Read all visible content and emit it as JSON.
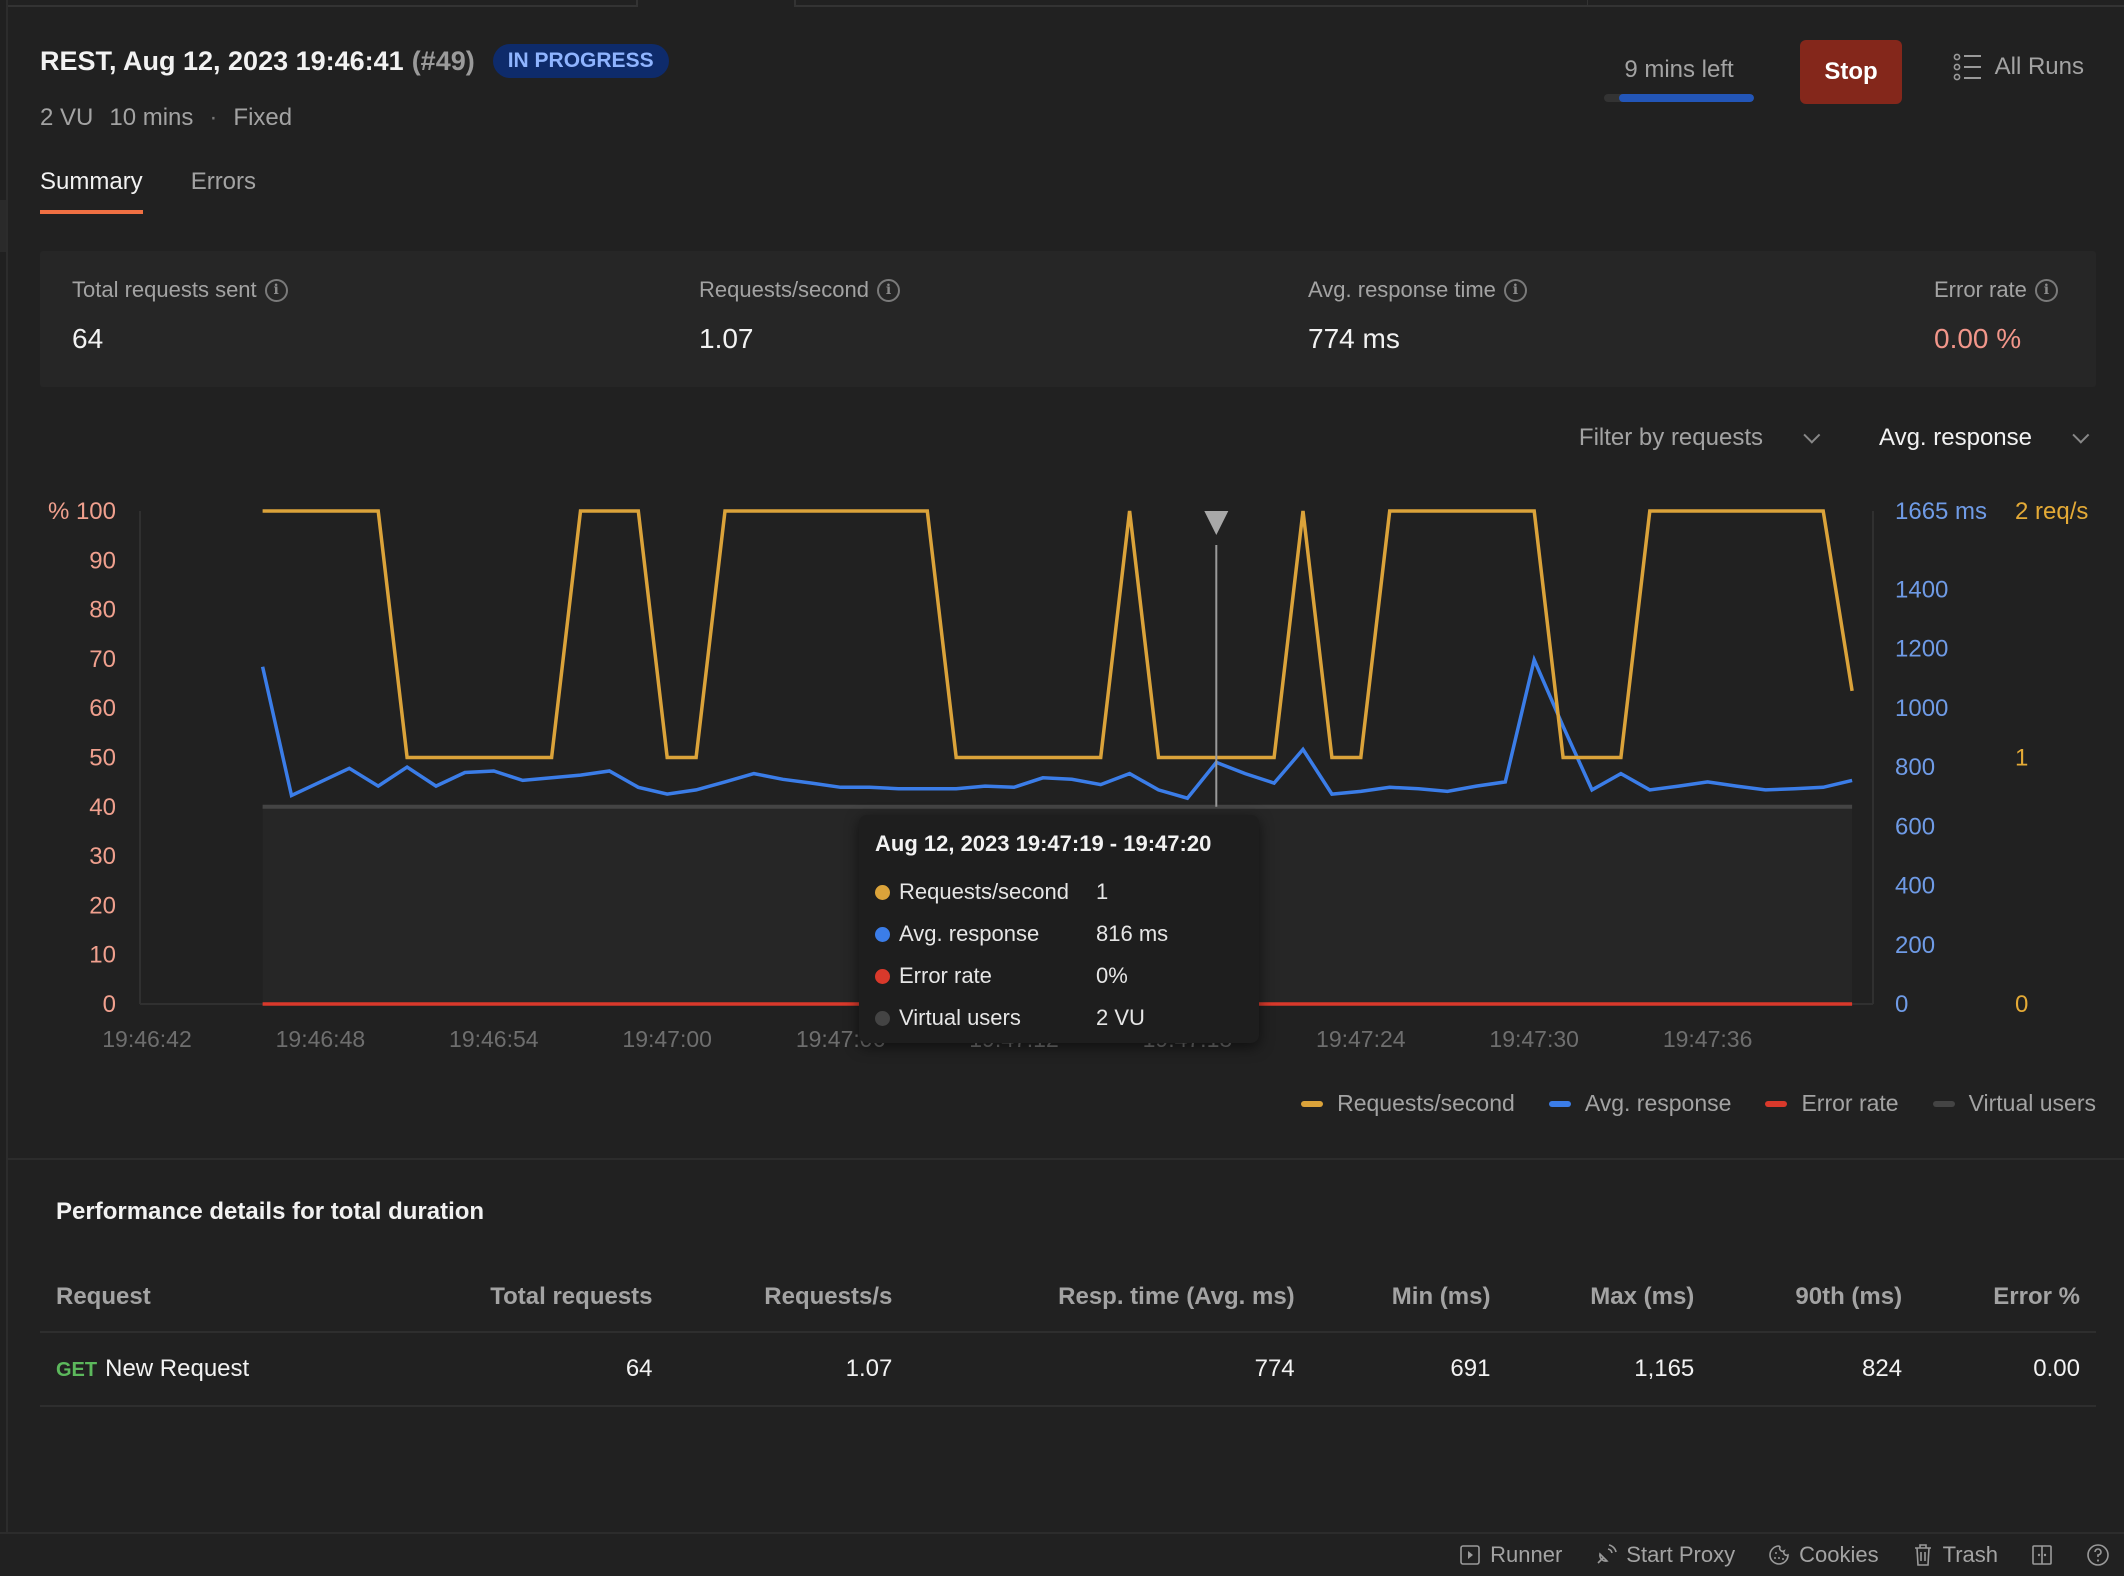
{
  "header": {
    "run_title": "REST, Aug 12, 2023 19:46:41",
    "run_number": "(#49)",
    "status": "IN PROGRESS",
    "meta": {
      "vus": "2 VU",
      "duration": "10 mins",
      "separator": "·",
      "profile": "Fixed"
    },
    "time_left": "9 mins left",
    "elapsed_fraction": 0.1,
    "stop_label": "Stop",
    "all_runs_label": "All Runs"
  },
  "tabs": [
    {
      "label": "Summary",
      "active": true
    },
    {
      "label": "Errors",
      "active": false
    }
  ],
  "stats": [
    {
      "label": "Total requests sent",
      "value": "64"
    },
    {
      "label": "Requests/second",
      "value": "1.07"
    },
    {
      "label": "Avg. response time",
      "value": "774 ms"
    },
    {
      "label": "Error rate",
      "value": "0.00 %"
    }
  ],
  "filters": {
    "request_filter": "Filter by requests",
    "metric": "Avg. response"
  },
  "tooltip": {
    "title": "Aug 12, 2023 19:47:19 - 19:47:20",
    "rows": [
      {
        "label": "Requests/second",
        "value": "1",
        "color": "#dba33a"
      },
      {
        "label": "Avg. response",
        "value": "816 ms",
        "color": "#3b7de8"
      },
      {
        "label": "Error rate",
        "value": "0%",
        "color": "#d9392b"
      },
      {
        "label": "Virtual users",
        "value": "2 VU",
        "color": "#444444"
      }
    ]
  },
  "chart_data": {
    "type": "line",
    "title": "",
    "x_start": "19:46:42",
    "x_step_seconds": 1,
    "x_ticks": [
      "19:46:42",
      "19:46:48",
      "19:46:54",
      "19:47:00",
      "19:47:06",
      "19:47:12",
      "19:47:18",
      "19:47:24",
      "19:47:30",
      "19:47:36"
    ],
    "x_tick_offsets_seconds": [
      0,
      6,
      12,
      18,
      24,
      30,
      36,
      42,
      48,
      54
    ],
    "x_range_seconds": [
      0,
      60
    ],
    "data_offset_seconds": [
      4,
      5,
      6,
      7,
      8,
      9,
      10,
      11,
      12,
      13,
      14,
      15,
      16,
      17,
      18,
      19,
      20,
      21,
      22,
      23,
      24,
      25,
      26,
      27,
      28,
      29,
      30,
      31,
      32,
      33,
      34,
      35,
      36,
      37,
      38,
      39,
      40,
      41,
      42,
      43,
      44,
      45,
      46,
      47,
      48,
      49,
      50,
      51,
      52,
      53,
      54,
      55,
      56,
      57,
      58,
      59
    ],
    "hover_offset_seconds": 37,
    "axes": {
      "left": {
        "label": "%",
        "ticks": [
          0,
          10,
          20,
          30,
          40,
          50,
          60,
          70,
          80,
          90,
          100
        ],
        "range": [
          0,
          100
        ],
        "color": "#f0a08e"
      },
      "right_ms": {
        "top_label": "1665 ms",
        "ticks": [
          0,
          200,
          400,
          600,
          800,
          1000,
          1200,
          1400
        ],
        "range": [
          0,
          1665
        ],
        "color": "#6f9be6"
      },
      "right_rps": {
        "top_label": "2 req/s",
        "ticks": [
          0,
          1
        ],
        "range": [
          0,
          2
        ],
        "color": "#e4aa36"
      }
    },
    "series": [
      {
        "name": "Requests/second",
        "axis": "right_rps",
        "color": "#dba33a",
        "values": [
          2,
          2,
          2,
          2,
          2,
          1,
          1,
          1,
          1,
          1,
          1,
          2,
          2,
          2,
          1,
          1,
          2,
          2,
          2,
          2,
          2,
          2,
          2,
          2,
          1,
          1,
          1,
          1,
          1,
          1,
          2,
          1,
          1,
          1,
          1,
          1,
          2,
          1,
          1,
          2,
          2,
          2,
          2,
          2,
          2,
          1,
          1,
          1,
          2,
          2,
          2,
          2,
          2,
          2,
          2,
          1.27
        ]
      },
      {
        "name": "Avg. response",
        "axis": "right_ms",
        "color": "#3b7de8",
        "values": [
          1139,
          704,
          750,
          796,
          736,
          800,
          736,
          782,
          787,
          755,
          764,
          773,
          787,
          732,
          709,
          723,
          750,
          778,
          759,
          746,
          732,
          732,
          727,
          727,
          727,
          736,
          732,
          764,
          759,
          741,
          778,
          723,
          695,
          816,
          778,
          746,
          860,
          709,
          718,
          732,
          727,
          718,
          736,
          750,
          1162,
          938,
          723,
          778,
          723,
          736,
          750,
          736,
          723,
          727,
          732,
          755
        ]
      },
      {
        "name": "Error rate",
        "axis": "left",
        "color": "#d9392b",
        "values": [
          0,
          0,
          0,
          0,
          0,
          0,
          0,
          0,
          0,
          0,
          0,
          0,
          0,
          0,
          0,
          0,
          0,
          0,
          0,
          0,
          0,
          0,
          0,
          0,
          0,
          0,
          0,
          0,
          0,
          0,
          0,
          0,
          0,
          0,
          0,
          0,
          0,
          0,
          0,
          0,
          0,
          0,
          0,
          0,
          0,
          0,
          0,
          0,
          0,
          0,
          0,
          0,
          0,
          0,
          0,
          0
        ]
      },
      {
        "name": "Virtual users",
        "axis": "left",
        "color": "#444444",
        "unit": "% of max (2 VU)",
        "values": [
          40,
          40,
          40,
          40,
          40,
          40,
          40,
          40,
          40,
          40,
          40,
          40,
          40,
          40,
          40,
          40,
          40,
          40,
          40,
          40,
          40,
          40,
          40,
          40,
          40,
          40,
          40,
          40,
          40,
          40,
          40,
          40,
          40,
          40,
          40,
          40,
          40,
          40,
          40,
          40,
          40,
          40,
          40,
          40,
          40,
          40,
          40,
          40,
          40,
          40,
          40,
          40,
          40,
          40,
          40,
          40
        ]
      }
    ],
    "legend": [
      "Requests/second",
      "Avg. response",
      "Error rate",
      "Virtual users"
    ],
    "legend_position": "bottom-right",
    "grid": false
  },
  "performance": {
    "title": "Performance details for total duration",
    "columns": [
      "Request",
      "Total requests",
      "Requests/s",
      "Resp. time (Avg. ms)",
      "Min (ms)",
      "Max (ms)",
      "90th (ms)",
      "Error %"
    ],
    "rows": [
      {
        "method": "GET",
        "name": "New Request",
        "total": "64",
        "rps": "1.07",
        "avg": "774",
        "min": "691",
        "max": "1,165",
        "p90": "824",
        "error": "0.00"
      }
    ]
  },
  "status_bar": [
    {
      "label": "Runner",
      "icon": "runner-icon"
    },
    {
      "label": "Start Proxy",
      "icon": "proxy-icon"
    },
    {
      "label": "Cookies",
      "icon": "cookie-icon"
    },
    {
      "label": "Trash",
      "icon": "trash-icon"
    },
    {
      "label": "",
      "icon": "two-pane-icon"
    },
    {
      "label": "",
      "icon": "help-icon"
    }
  ]
}
